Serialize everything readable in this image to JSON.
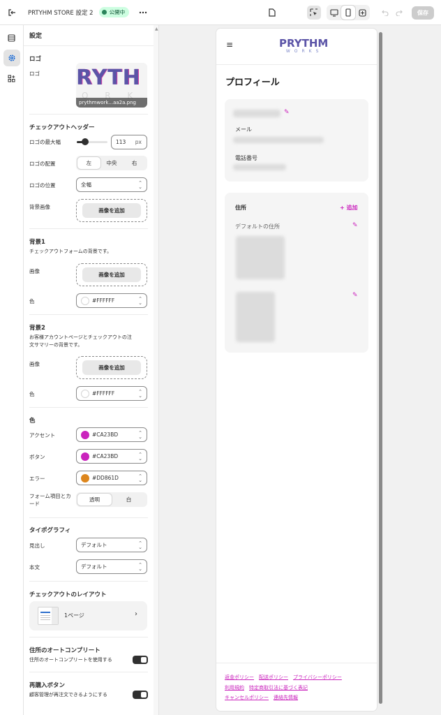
{
  "topbar": {
    "store_name": "PRTYHM STORE 設定 2",
    "status": "公開中",
    "save_label": "保存"
  },
  "panel": {
    "title": "設定",
    "logo_section": {
      "title": "ロゴ",
      "label": "ロゴ",
      "logo_text": "RYTH",
      "logo_sub": "O R K",
      "file_name": "prythmwork...aa2a.png"
    },
    "checkout_header": {
      "title": "チェックアウトヘッダー",
      "max_width_label": "ロゴの最大幅",
      "max_width_value": "113",
      "max_width_unit": "px",
      "max_width_slider": 0.26,
      "alignment_label": "ロゴの配置",
      "alignment_options": [
        "左",
        "中央",
        "右"
      ],
      "alignment_selected": "左",
      "position_label": "ロゴの位置",
      "position_value": "全幅",
      "bg_image_label": "背景画像",
      "add_image": "画像を追加"
    },
    "background1": {
      "title": "背景1",
      "desc": "チェックアウトフォームの背景です。",
      "image_label": "画像",
      "add_image": "画像を追加",
      "color_label": "色",
      "color_value": "#FFFFFF"
    },
    "background2": {
      "title": "背景2",
      "desc_line1": "お客様アカウントページとチェックアウトの注",
      "desc_line2": "文サマリーの背景です。",
      "image_label": "画像",
      "add_image": "画像を追加",
      "color_label": "色",
      "color_value": "#FFFFFF"
    },
    "colors": {
      "title": "色",
      "accent_label": "アクセント",
      "accent_value": "#CA23BD",
      "button_label": "ボタン",
      "button_value": "#CA23BD",
      "error_label": "エラー",
      "error_value": "#DD861D",
      "form_label_line1": "フォーム項目とカ",
      "form_label_line2": "ード",
      "form_options": [
        "透明",
        "白"
      ],
      "form_selected": "透明"
    },
    "typography": {
      "title": "タイポグラフィ",
      "heading_label": "見出し",
      "heading_value": "デフォルト",
      "body_label": "本文",
      "body_value": "デフォルト"
    },
    "layout": {
      "title": "チェックアウトのレイアウト",
      "value": "1ページ"
    },
    "autocomplete": {
      "title": "住所のオートコンプリート",
      "label": "住所のオートコンプリートを使用する",
      "enabled": true
    },
    "reorder": {
      "title": "再購入ボタン",
      "label": "顧客管理が再注文できるようにする",
      "enabled": true
    }
  },
  "preview": {
    "logo_main": "PRYTHM",
    "logo_sub": "WORKS",
    "page_title": "プロフィール",
    "email_label": "メール",
    "phone_label": "電話番号",
    "address_title": "住所",
    "add_label": "+ 追加",
    "default_address_label": "デフォルトの住所",
    "footer_links": [
      "返金ポリシー",
      "配送ポリシー",
      "プライバシーポリシー",
      "利用規約",
      "特定商取引法に基づく表記",
      "キャンセルポリシー",
      "連絡先情報"
    ]
  },
  "colors": {
    "accent": "#CA23BD",
    "error": "#DD861D",
    "status": "#29845A"
  }
}
